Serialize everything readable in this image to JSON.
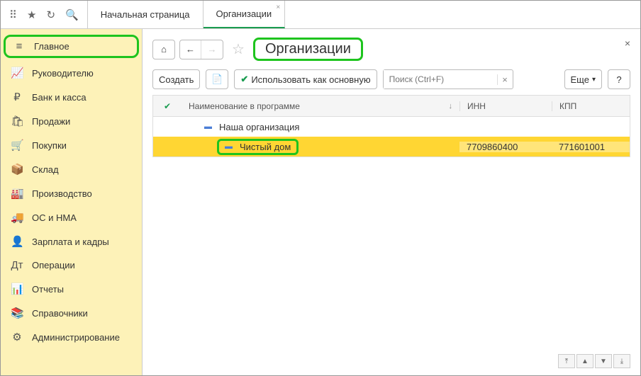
{
  "topbar": {
    "tabs": [
      {
        "label": "Начальная страница",
        "active": false
      },
      {
        "label": "Организации",
        "active": true
      }
    ]
  },
  "sidebar": {
    "items": [
      {
        "icon": "menu",
        "label": "Главное",
        "highlight": true
      },
      {
        "icon": "chart",
        "label": "Руководителю"
      },
      {
        "icon": "ruble",
        "label": "Банк и касса"
      },
      {
        "icon": "bag",
        "label": "Продажи"
      },
      {
        "icon": "cart",
        "label": "Покупки"
      },
      {
        "icon": "box",
        "label": "Склад"
      },
      {
        "icon": "factory",
        "label": "Производство"
      },
      {
        "icon": "truck",
        "label": "ОС и НМА"
      },
      {
        "icon": "person",
        "label": "Зарплата и кадры"
      },
      {
        "icon": "ops",
        "label": "Операции"
      },
      {
        "icon": "reports",
        "label": "Отчеты"
      },
      {
        "icon": "book",
        "label": "Справочники"
      },
      {
        "icon": "gear",
        "label": "Администрирование"
      }
    ]
  },
  "page": {
    "title": "Организации",
    "create_label": "Создать",
    "use_as_main_label": "Использовать как основную",
    "search_placeholder": "Поиск (Ctrl+F)",
    "more_label": "Еще",
    "help_label": "?"
  },
  "table": {
    "columns": {
      "name": "Наименование в программе",
      "inn": "ИНН",
      "kpp": "КПП"
    },
    "rows": [
      {
        "name": "Наша организация",
        "inn": "",
        "kpp": "",
        "indent": 1,
        "selected": false
      },
      {
        "name": "Чистый дом",
        "inn": "7709860400",
        "kpp": "771601001",
        "indent": 2,
        "selected": true,
        "highlight": true
      }
    ]
  }
}
